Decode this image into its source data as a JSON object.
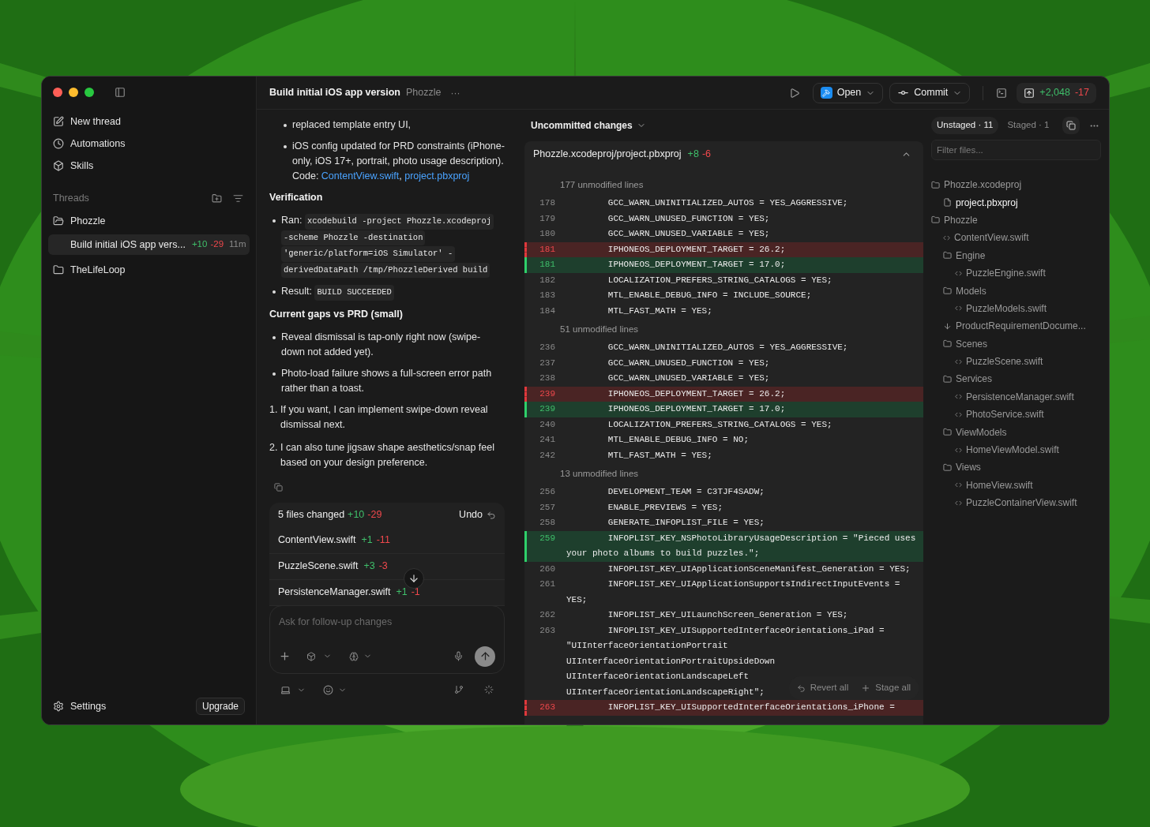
{
  "sidebar": {
    "nav": [
      {
        "label": "New thread"
      },
      {
        "label": "Automations"
      },
      {
        "label": "Skills"
      }
    ],
    "threads_label": "Threads",
    "projects": [
      {
        "name": "Phozzle",
        "expanded": true,
        "threads": [
          {
            "title": "Build initial iOS app vers...",
            "added": "+10",
            "removed": "-29",
            "age": "11m",
            "selected": true
          }
        ]
      },
      {
        "name": "TheLifeLoop",
        "expanded": false
      }
    ],
    "settings": "Settings",
    "upgrade": "Upgrade"
  },
  "topbar": {
    "title": "Build initial iOS app version",
    "project": "Phozzle",
    "more": "···",
    "open": "Open",
    "commit": "Commit",
    "added": "+2,048",
    "removed": "-17"
  },
  "chat": {
    "blocks": [
      {
        "kind": "subbullet",
        "lines": [
          [
            {
              "kind": "text",
              "text": "replaced template entry UI,"
            }
          ]
        ]
      },
      {
        "kind": "subbullet",
        "lines": [
          [
            {
              "kind": "text",
              "text": "iOS config updated for PRD constraints (iPhone-only, iOS 17+, portrait, photo usage description)."
            }
          ],
          [
            {
              "kind": "text",
              "text": "Code: "
            },
            {
              "kind": "link",
              "text": "ContentView.swift"
            },
            {
              "kind": "text",
              "text": ", "
            },
            {
              "kind": "link",
              "text": "project.pbxproj"
            }
          ]
        ]
      },
      {
        "kind": "heading",
        "text": "Verification"
      },
      {
        "kind": "bullet",
        "lines": [
          [
            {
              "kind": "text",
              "text": "Ran: "
            },
            {
              "kind": "code",
              "text": "xcodebuild -project Phozzle.xcodeproj"
            },
            {
              "kind": "code",
              "text": "-scheme Phozzle -destination"
            },
            {
              "kind": "code",
              "text": "'generic/platform=iOS Simulator' -"
            },
            {
              "kind": "code",
              "text": "derivedDataPath /tmp/PhozzleDerived build"
            }
          ]
        ]
      },
      {
        "kind": "bullet",
        "lines": [
          [
            {
              "kind": "text",
              "text": "Result: "
            },
            {
              "kind": "code",
              "text": "BUILD SUCCEEDED"
            }
          ]
        ]
      },
      {
        "kind": "heading",
        "text": "Current gaps vs PRD (small)"
      },
      {
        "kind": "bullet",
        "lines": [
          [
            {
              "kind": "text",
              "text": "Reveal dismissal is tap-only right now (swipe-down not added yet)."
            }
          ]
        ]
      },
      {
        "kind": "bullet",
        "lines": [
          [
            {
              "kind": "text",
              "text": "Photo-load failure shows a full-screen error path rather than a toast."
            }
          ]
        ]
      },
      {
        "kind": "numbered",
        "marker": "1.",
        "lines": [
          [
            {
              "kind": "text",
              "text": "If you want, I can implement swipe-down reveal dismissal next."
            }
          ]
        ]
      },
      {
        "kind": "numbered",
        "marker": "2.",
        "lines": [
          [
            {
              "kind": "text",
              "text": "I can also tune jigsaw shape aesthetics/snap feel based on your design preference."
            }
          ]
        ]
      }
    ],
    "changes": {
      "summary": "5 files changed",
      "added": "+10",
      "removed": "-29",
      "undo": "Undo",
      "files": [
        {
          "name": "ContentView.swift",
          "added": "+1",
          "removed": "-11"
        },
        {
          "name": "PuzzleScene.swift",
          "added": "+3",
          "removed": "-3"
        },
        {
          "name": "PersistenceManager.swift",
          "added": "+1",
          "removed": "-1"
        }
      ]
    },
    "composer": {
      "placeholder": "Ask for follow-up changes"
    }
  },
  "diff": {
    "heading": "Uncommitted changes",
    "file": "Phozzle.xcodeproj/project.pbxproj",
    "added": "+8",
    "removed": "-6",
    "lines": [
      {
        "kind": "skip",
        "text": "177 unmodified lines"
      },
      {
        "kind": "context",
        "num": "178",
        "text": "GCC_WARN_UNINITIALIZED_AUTOS = YES_AGGRESSIVE;"
      },
      {
        "kind": "context",
        "num": "179",
        "text": "GCC_WARN_UNUSED_FUNCTION = YES;"
      },
      {
        "kind": "context",
        "num": "180",
        "text": "GCC_WARN_UNUSED_VARIABLE = YES;"
      },
      {
        "kind": "removed",
        "num": "181",
        "text": "IPHONEOS_DEPLOYMENT_TARGET = 26.2;"
      },
      {
        "kind": "added",
        "num": "181",
        "text": "IPHONEOS_DEPLOYMENT_TARGET = 17.0;"
      },
      {
        "kind": "context",
        "num": "182",
        "text": "LOCALIZATION_PREFERS_STRING_CATALOGS = YES;"
      },
      {
        "kind": "context",
        "num": "183",
        "text": "MTL_ENABLE_DEBUG_INFO = INCLUDE_SOURCE;"
      },
      {
        "kind": "context",
        "num": "184",
        "text": "MTL_FAST_MATH = YES;"
      },
      {
        "kind": "skip",
        "text": "51 unmodified lines"
      },
      {
        "kind": "context",
        "num": "236",
        "text": "GCC_WARN_UNINITIALIZED_AUTOS = YES_AGGRESSIVE;"
      },
      {
        "kind": "context",
        "num": "237",
        "text": "GCC_WARN_UNUSED_FUNCTION = YES;"
      },
      {
        "kind": "context",
        "num": "238",
        "text": "GCC_WARN_UNUSED_VARIABLE = YES;"
      },
      {
        "kind": "removed",
        "num": "239",
        "text": "IPHONEOS_DEPLOYMENT_TARGET = 26.2;"
      },
      {
        "kind": "added",
        "num": "239",
        "text": "IPHONEOS_DEPLOYMENT_TARGET = 17.0;"
      },
      {
        "kind": "context",
        "num": "240",
        "text": "LOCALIZATION_PREFERS_STRING_CATALOGS = YES;"
      },
      {
        "kind": "context",
        "num": "241",
        "text": "MTL_ENABLE_DEBUG_INFO = NO;"
      },
      {
        "kind": "context",
        "num": "242",
        "text": "MTL_FAST_MATH = YES;"
      },
      {
        "kind": "skip",
        "text": "13 unmodified lines"
      },
      {
        "kind": "context",
        "num": "256",
        "text": "DEVELOPMENT_TEAM = C3TJF4SADW;"
      },
      {
        "kind": "context",
        "num": "257",
        "text": "ENABLE_PREVIEWS = YES;"
      },
      {
        "kind": "context",
        "num": "258",
        "text": "GENERATE_INFOPLIST_FILE = YES;"
      },
      {
        "kind": "added",
        "num": "259",
        "rows": [
          "INFOPLIST_KEY_NSPhotoLibraryUsageDescription = \"Pieced uses",
          "your photo albums to build puzzles.\";"
        ]
      },
      {
        "kind": "context",
        "num": "260",
        "text": "INFOPLIST_KEY_UIApplicationSceneManifest_Generation = YES;"
      },
      {
        "kind": "context",
        "num": "261",
        "rows": [
          "INFOPLIST_KEY_UIApplicationSupportsIndirectInputEvents =",
          "YES;"
        ]
      },
      {
        "kind": "context",
        "num": "262",
        "text": "INFOPLIST_KEY_UILaunchScreen_Generation = YES;"
      },
      {
        "kind": "context",
        "num": "263",
        "rows": [
          "INFOPLIST_KEY_UISupportedInterfaceOrientations_iPad =",
          "\"UIInterfaceOrientationPortrait",
          "UIInterfaceOrientationPortraitUpsideDown",
          "UIInterfaceOrientationLandscapeLeft",
          "UIInterfaceOrientationLandscapeRight\";"
        ]
      },
      {
        "kind": "removed",
        "num": "263",
        "text": "INFOPLIST_KEY_UISupportedInterfaceOrientations_iPhone ="
      }
    ],
    "revert": "Revert all",
    "stage": "Stage all"
  },
  "files_panel": {
    "tabs": [
      {
        "label": "Unstaged · 11",
        "selected": true
      },
      {
        "label": "Staged · 1",
        "selected": false
      }
    ],
    "filter": {
      "placeholder": "Filter files..."
    },
    "tree": [
      {
        "kind": "folder",
        "name": "Phozzle.xcodeproj",
        "selected": false,
        "children": [
          {
            "kind": "file",
            "name": "project.pbxproj",
            "selected": true
          }
        ]
      },
      {
        "kind": "folder",
        "name": "Phozzle",
        "selected": false,
        "children": [
          {
            "kind": "swift",
            "name": "ContentView.swift",
            "selected": false
          },
          {
            "kind": "folder",
            "name": "Engine",
            "selected": false,
            "children": [
              {
                "kind": "swift",
                "name": "PuzzleEngine.swift",
                "selected": false
              }
            ]
          },
          {
            "kind": "folder",
            "name": "Models",
            "selected": false,
            "children": [
              {
                "kind": "swift",
                "name": "PuzzleModels.swift",
                "selected": false
              }
            ]
          },
          {
            "kind": "download",
            "name": "ProductRequirementDocume...",
            "selected": false
          },
          {
            "kind": "folder",
            "name": "Scenes",
            "selected": false,
            "children": [
              {
                "kind": "swift",
                "name": "PuzzleScene.swift",
                "selected": false
              }
            ]
          },
          {
            "kind": "folder",
            "name": "Services",
            "selected": false,
            "children": [
              {
                "kind": "swift",
                "name": "PersistenceManager.swift",
                "selected": false
              },
              {
                "kind": "swift",
                "name": "PhotoService.swift",
                "selected": false
              }
            ]
          },
          {
            "kind": "folder",
            "name": "ViewModels",
            "selected": false,
            "children": [
              {
                "kind": "swift",
                "name": "HomeViewModel.swift",
                "selected": false
              }
            ]
          },
          {
            "kind": "folder",
            "name": "Views",
            "selected": false,
            "children": [
              {
                "kind": "swift",
                "name": "HomeView.swift",
                "selected": false
              },
              {
                "kind": "swift",
                "name": "PuzzleContainerView.swift",
                "selected": false
              }
            ]
          }
        ]
      }
    ]
  }
}
